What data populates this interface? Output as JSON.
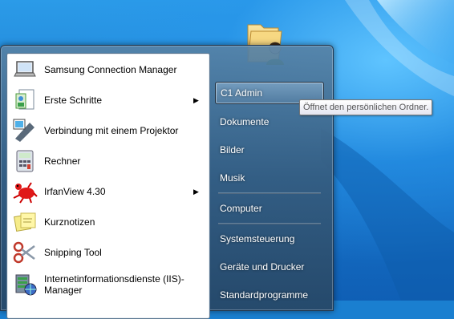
{
  "left_pane": {
    "items": [
      {
        "label": "Samsung Connection Manager",
        "icon": "laptop-icon",
        "has_submenu": false
      },
      {
        "label": "Erste Schritte",
        "icon": "getting-started-icon",
        "has_submenu": true
      },
      {
        "label": "Verbindung mit einem Projektor",
        "icon": "projector-icon",
        "has_submenu": false
      },
      {
        "label": "Rechner",
        "icon": "calculator-icon",
        "has_submenu": false
      },
      {
        "label": "IrfanView 4.30",
        "icon": "irfanview-icon",
        "has_submenu": true
      },
      {
        "label": "Kurznotizen",
        "icon": "sticky-notes-icon",
        "has_submenu": false
      },
      {
        "label": "Snipping Tool",
        "icon": "scissors-icon",
        "has_submenu": false
      },
      {
        "label": "Internetinformationsdienste (IIS)-Manager",
        "icon": "iis-manager-icon",
        "has_submenu": false
      }
    ],
    "submenu_arrow": "▶"
  },
  "right_pane": {
    "items": [
      {
        "label": "C1 Admin"
      },
      {
        "label": "Dokumente"
      },
      {
        "label": "Bilder"
      },
      {
        "label": "Musik"
      },
      {
        "label": "Computer"
      },
      {
        "label": "Systemsteuerung"
      },
      {
        "label": "Geräte und Drucker"
      },
      {
        "label": "Standardprogramme"
      }
    ]
  },
  "tooltip": {
    "text": "Öffnet den persönlichen Ordner."
  },
  "user_tile": {
    "icon": "user-folder-icon"
  }
}
